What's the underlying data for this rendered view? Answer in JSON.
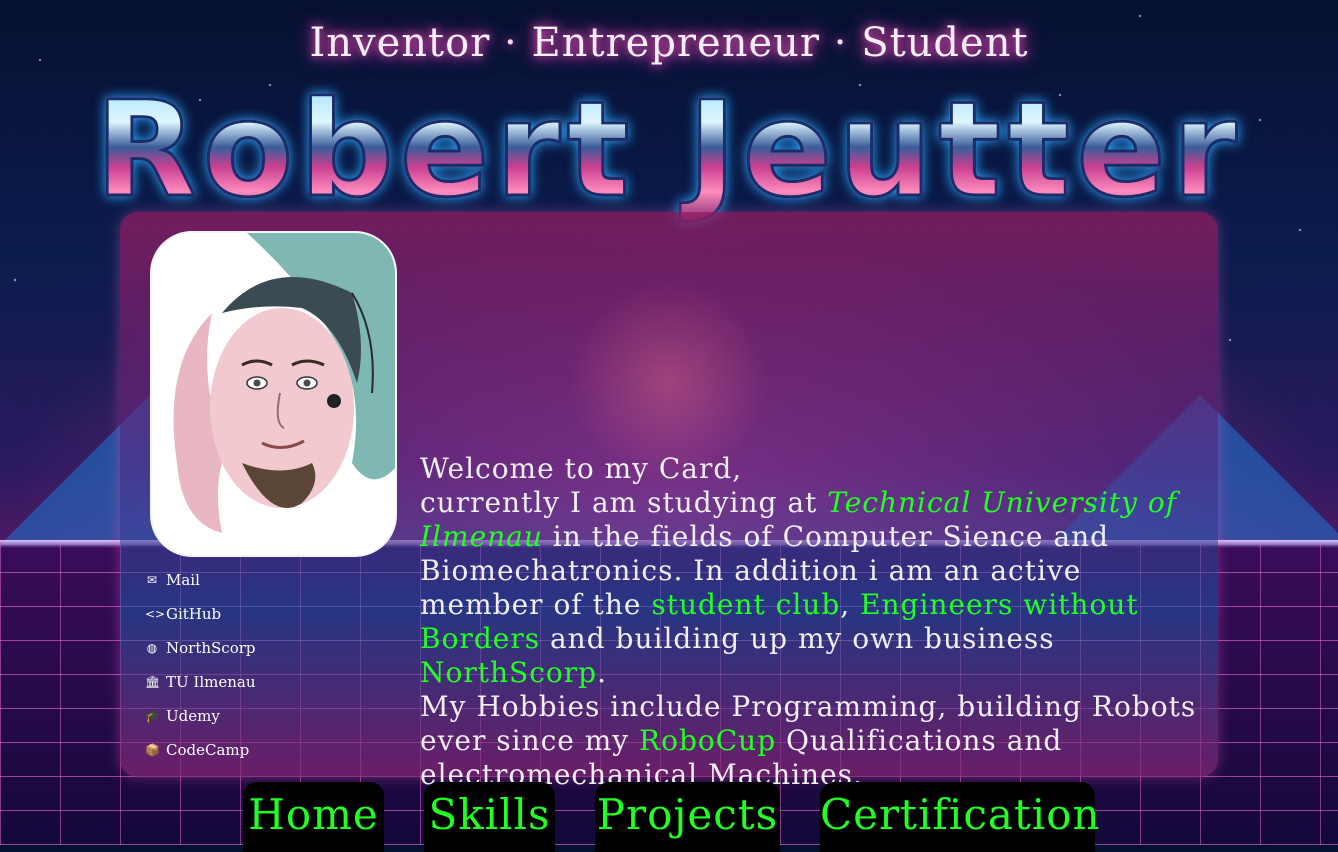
{
  "header": {
    "tagline_parts": [
      "Inventor",
      "Entrepreneur",
      "Student"
    ],
    "separator": "·",
    "name": "Robert Jeutter"
  },
  "sidebar": {
    "links": [
      {
        "icon": "mail-icon",
        "glyph": "✉",
        "label": "Mail"
      },
      {
        "icon": "code-icon",
        "glyph": "<>",
        "label": "GitHub"
      },
      {
        "icon": "globe-icon",
        "glyph": "◍",
        "label": "NorthScorp"
      },
      {
        "icon": "university-icon",
        "glyph": "🏛",
        "label": "TU Ilmenau"
      },
      {
        "icon": "graduation-cap-icon",
        "glyph": "🎓",
        "label": "Udemy"
      },
      {
        "icon": "box-icon",
        "glyph": "📦",
        "label": "CodeCamp"
      }
    ]
  },
  "bio": {
    "line1": "Welcome to my Card,",
    "p1": "currently I am studying at ",
    "university": "Technical University of Ilmenau",
    "p2": " in the fields of Computer Sience and Biomechatronics.  In addition i am an active member of the ",
    "student_club": "student club",
    "comma": ",",
    "ewb": " Engineers without Borders",
    "p3": "  and building up my own business ",
    "northscorp": "NorthScorp",
    "p4": ".",
    "p5": "My Hobbies include Programming, building Robots ever since my ",
    "robocup": "RoboCup",
    "p6": " Qualifications and electromechanical Machines."
  },
  "nav": {
    "home": "Home",
    "skills": "Skills",
    "projects": "Projects",
    "certification": "Certification"
  },
  "colors": {
    "accent_green": "#22ff22",
    "pink_glow": "#ff5ac8",
    "nav_bg": "#000000"
  }
}
